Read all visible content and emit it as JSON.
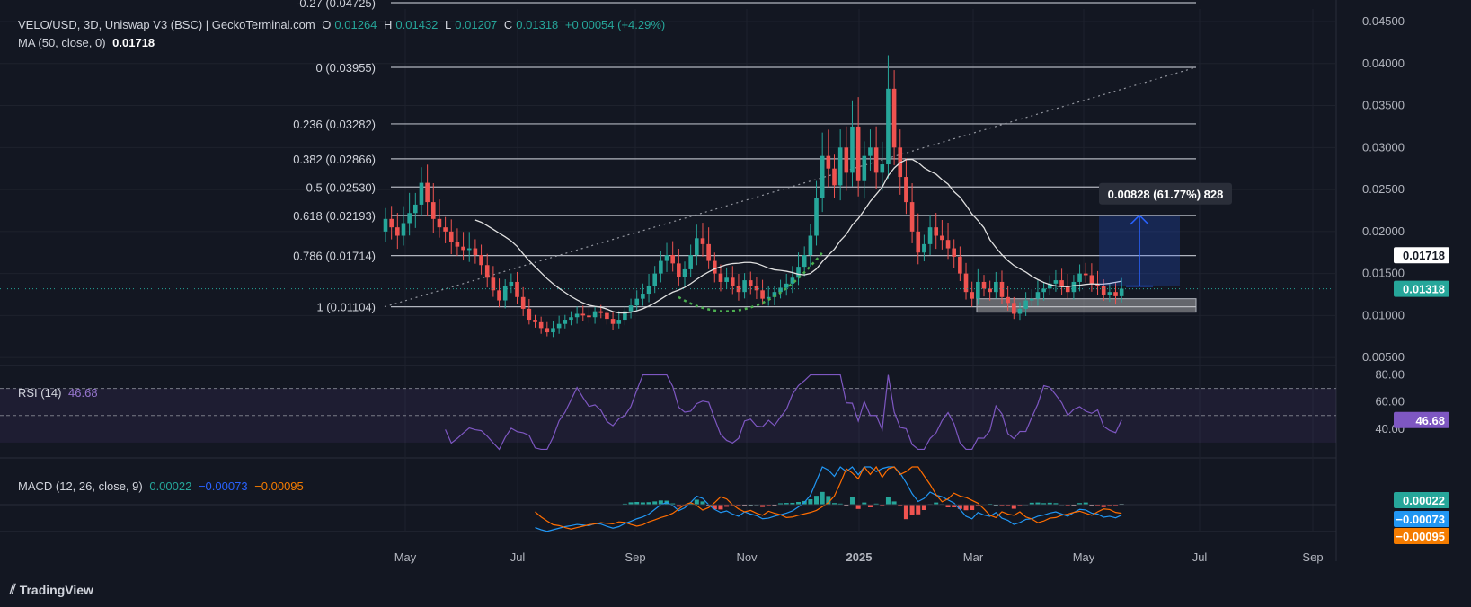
{
  "header": {
    "symbol": "VELO/USD, 3D, Uniswap V3 (BSC) | GeckoTerminal.com",
    "o_label": "O",
    "o_val": "0.01264",
    "h_label": "H",
    "h_val": "0.01432",
    "l_label": "L",
    "l_val": "0.01207",
    "c_label": "C",
    "c_val": "0.01318",
    "change": "+0.00054 (+4.29%)",
    "ma_label": "MA (50, close, 0)",
    "ma_val": "0.01718"
  },
  "rsi_header": {
    "label": "RSI (14)",
    "value": "46.68"
  },
  "macd_header": {
    "label": "MACD (12, 26, close, 9)",
    "hist": "0.00022",
    "macd": "−0.00073",
    "signal": "−0.00095"
  },
  "measure_label": "0.00828 (61.77%) 828",
  "brand": "TradingView",
  "colors": {
    "up": "#26a69a",
    "down": "#ef5350",
    "bg": "#131722",
    "rsi": "#7e57c2",
    "macd": "#2196f3",
    "signal": "#ff6d00"
  },
  "chart_data": {
    "type": "candlestick",
    "y_axis": {
      "range": [
        0.0048,
        0.0465
      ],
      "ticks": [
        "0.04500",
        "0.04000",
        "0.03500",
        "0.03000",
        "0.02500",
        "0.02000",
        "0.01500",
        "0.01000",
        "0.00500"
      ]
    },
    "x_axis": {
      "ticks": [
        "May",
        "Jul",
        "Sep",
        "Nov",
        "2025",
        "Mar",
        "May",
        "Jul",
        "Sep"
      ]
    },
    "price_labels": {
      "ma": "0.01718",
      "last": "0.01318"
    },
    "fib_levels": [
      {
        "label": "-0.27 (0.04725)",
        "value": 0.04725
      },
      {
        "label": "0 (0.03955)",
        "value": 0.03955
      },
      {
        "label": "0.236 (0.03282)",
        "value": 0.03282
      },
      {
        "label": "0.382 (0.02866)",
        "value": 0.02866
      },
      {
        "label": "0.5 (0.02530)",
        "value": 0.0253
      },
      {
        "label": "0.618 (0.02193)",
        "value": 0.02193
      },
      {
        "label": "0.786 (0.01714)",
        "value": 0.01714
      },
      {
        "label": "1 (0.01104)",
        "value": 0.01104
      }
    ],
    "closes": [
      0.0215,
      0.0205,
      0.0195,
      0.021,
      0.0222,
      0.0232,
      0.0258,
      0.0235,
      0.0215,
      0.0205,
      0.02,
      0.0188,
      0.0182,
      0.0178,
      0.018,
      0.0172,
      0.016,
      0.0145,
      0.013,
      0.0118,
      0.0135,
      0.014,
      0.0122,
      0.0108,
      0.0095,
      0.0092,
      0.0085,
      0.008,
      0.0085,
      0.009,
      0.0095,
      0.0098,
      0.0102,
      0.01,
      0.0098,
      0.0105,
      0.0103,
      0.0096,
      0.009,
      0.0095,
      0.0105,
      0.0112,
      0.012,
      0.0126,
      0.0135,
      0.015,
      0.0165,
      0.0172,
      0.0162,
      0.0146,
      0.0155,
      0.0172,
      0.0192,
      0.0185,
      0.0165,
      0.015,
      0.014,
      0.0145,
      0.0135,
      0.0128,
      0.0142,
      0.0135,
      0.013,
      0.012,
      0.0122,
      0.0128,
      0.0133,
      0.0138,
      0.0145,
      0.0158,
      0.0172,
      0.0195,
      0.024,
      0.029,
      0.0275,
      0.0255,
      0.03,
      0.027,
      0.0325,
      0.026,
      0.029,
      0.03,
      0.027,
      0.028,
      0.037,
      0.03,
      0.0265,
      0.0235,
      0.02,
      0.0175,
      0.0185,
      0.0205,
      0.0195,
      0.019,
      0.018,
      0.017,
      0.015,
      0.0128,
      0.012,
      0.014,
      0.0132,
      0.0128,
      0.014,
      0.0122,
      0.0115,
      0.0102,
      0.0108,
      0.0118,
      0.012,
      0.0128,
      0.0132,
      0.0138,
      0.0142,
      0.0135,
      0.0128,
      0.014,
      0.015,
      0.0148,
      0.0138,
      0.0135,
      0.0125,
      0.0128,
      0.0123,
      0.0132
    ],
    "rsi": {
      "value": 46.68,
      "ticks": [
        "80.00",
        "60.00",
        "40.00"
      ],
      "bands": [
        70,
        30
      ]
    },
    "macd": {
      "hist": 0.00022,
      "macd": -0.00073,
      "signal": -0.00095
    },
    "measure": {
      "from": 0.0135,
      "to": 0.02193,
      "text": "0.00828 (61.77%) 828"
    }
  }
}
